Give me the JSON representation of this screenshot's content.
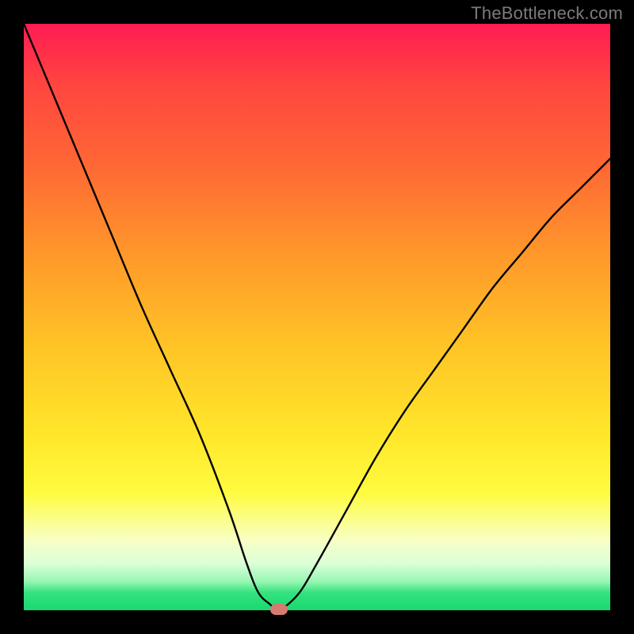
{
  "watermark": "TheBottleneck.com",
  "colors": {
    "frame": "#000000",
    "gradient_top": "#ff1c53",
    "gradient_bottom": "#18d96f",
    "curve": "#000000",
    "marker": "#d67a72",
    "watermark": "#7b7b7b"
  },
  "chart_data": {
    "type": "line",
    "title": "",
    "xlabel": "",
    "ylabel": "",
    "xlim": [
      0,
      100
    ],
    "ylim": [
      0,
      100
    ],
    "series": [
      {
        "name": "bottleneck-curve",
        "x": [
          0,
          5,
          10,
          15,
          20,
          25,
          30,
          35,
          38,
          40,
          42,
          43,
          44,
          47,
          50,
          55,
          60,
          65,
          70,
          75,
          80,
          85,
          90,
          95,
          100
        ],
        "values": [
          100,
          88,
          76,
          64,
          52,
          41,
          30,
          17,
          8,
          3,
          1,
          0.2,
          0.2,
          3,
          8,
          17,
          26,
          34,
          41,
          48,
          55,
          61,
          67,
          72,
          77
        ]
      }
    ],
    "annotations": [
      {
        "name": "optimum-marker",
        "x": 43.5,
        "y": 0.2
      }
    ],
    "gradient_meaning": "top=red=high-bottleneck, bottom=green=no-bottleneck"
  }
}
